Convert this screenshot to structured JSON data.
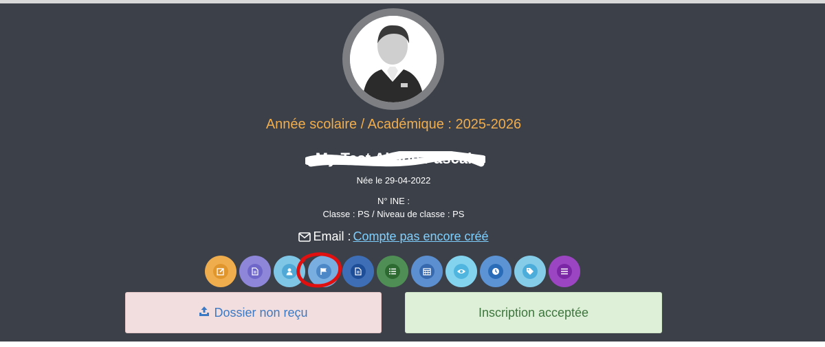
{
  "profile": {
    "school_year": "Année scolaire / Académique : 2025-2026",
    "student_name": "My Test Alcide Pascal",
    "birth": "Née le 29-04-2022",
    "ine": "N° INE :",
    "classe": "Classe : PS / Niveau de classe : PS"
  },
  "email": {
    "label": "Email :",
    "link": "Compte pas encore créé"
  },
  "actions": [
    {
      "name": "edit-icon",
      "color": "#f0ad4e",
      "inner": "#e0962c"
    },
    {
      "name": "document-icon",
      "color": "#8e86d8",
      "inner": "#6f66c9"
    },
    {
      "name": "user-icon",
      "color": "#7fc6e6",
      "inner": "#4fa8d6"
    },
    {
      "name": "flag-icon",
      "color": "#78aee0",
      "inner": "#4c88c8"
    },
    {
      "name": "file-icon",
      "color": "#3e6fb6",
      "inner": "#1f4e99"
    },
    {
      "name": "list-icon",
      "color": "#4f8f55",
      "inner": "#2c6a32"
    },
    {
      "name": "calendar-icon",
      "color": "#5c8fcf",
      "inner": "#3669ad"
    },
    {
      "name": "eye-icon",
      "color": "#84d3ee",
      "inner": "#50b6df"
    },
    {
      "name": "clock-icon",
      "color": "#5b93d4",
      "inner": "#2b6cb8"
    },
    {
      "name": "tag-icon",
      "color": "#84cce8",
      "inner": "#4caddb"
    },
    {
      "name": "menu-icon",
      "color": "#9b45c2",
      "inner": "#7a26a5"
    }
  ],
  "status": {
    "dossier": "Dossier non reçu",
    "inscription": "Inscription acceptée"
  },
  "colors": {
    "panel": "#3b4049",
    "accent_orange": "#f0ad4e",
    "link": "#7fd0ff",
    "highlight_red": "#e01010"
  }
}
